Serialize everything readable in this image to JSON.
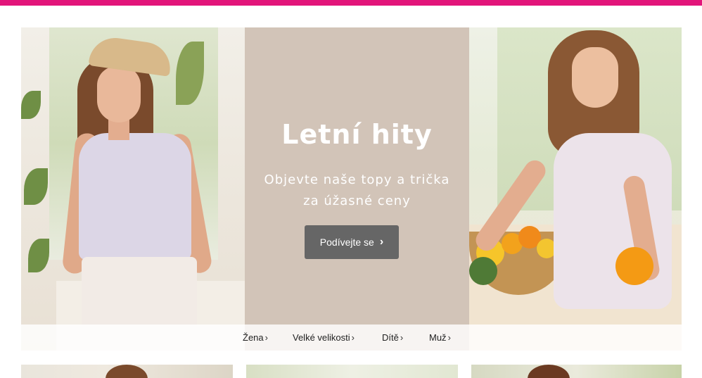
{
  "colors": {
    "brand": "#e2157a",
    "button": "#666666",
    "text": "#222222"
  },
  "hero": {
    "title": "Letní hity",
    "subtitle": "Objevte naše topy a trička za úžasné ceny",
    "cta_label": "Podívejte se",
    "cta_icon": "chevron-right-icon"
  },
  "categories": [
    {
      "label": "Žena",
      "icon": "chevron-right-icon"
    },
    {
      "label": "Velké velikosti",
      "icon": "chevron-right-icon"
    },
    {
      "label": "Dítě",
      "icon": "chevron-right-icon"
    },
    {
      "label": "Muž",
      "icon": "chevron-right-icon"
    }
  ],
  "tiles": [
    {
      "name": "promo-tile-1"
    },
    {
      "name": "promo-tile-2"
    },
    {
      "name": "promo-tile-3"
    }
  ]
}
